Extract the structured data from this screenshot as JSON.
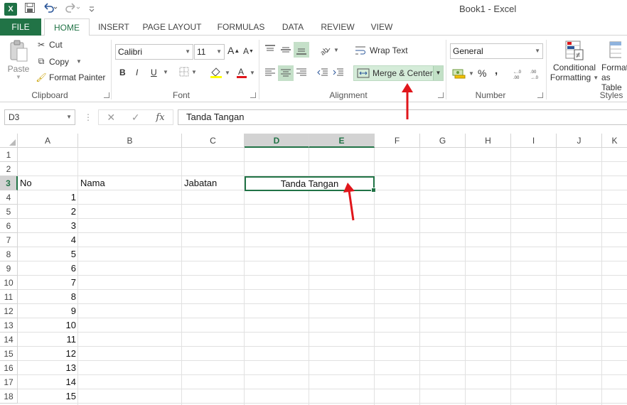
{
  "window": {
    "title": "Book1 - Excel",
    "app_icon": "X"
  },
  "qat": {
    "save_icon": "save-icon",
    "undo_icon": "undo-icon",
    "redo_icon": "redo-icon"
  },
  "tabs": [
    "FILE",
    "HOME",
    "INSERT",
    "PAGE LAYOUT",
    "FORMULAS",
    "DATA",
    "REVIEW",
    "VIEW"
  ],
  "ribbon": {
    "clipboard": {
      "paste": "Paste",
      "cut": "Cut",
      "copy": "Copy",
      "format_painter": "Format Painter",
      "label": "Clipboard"
    },
    "font": {
      "name": "Calibri",
      "size": "11",
      "bold": "B",
      "italic": "I",
      "underline": "U",
      "label": "Font",
      "grow": "A",
      "shrink": "A"
    },
    "alignment": {
      "wrap_text": "Wrap Text",
      "merge_center": "Merge & Center",
      "label": "Alignment"
    },
    "number": {
      "format": "General",
      "percent": "%",
      "comma": ",",
      "inc_decimal": ".00 .0",
      "label": "Number"
    },
    "styles": {
      "conditional_1": "Conditional",
      "conditional_2": "Formatting",
      "format_table_1": "Format as",
      "format_table_2": "Table",
      "label": "Styles"
    }
  },
  "formula_bar": {
    "name_box": "D3",
    "fx": "fx",
    "value": "Tanda Tangan"
  },
  "sheet": {
    "columns": [
      "A",
      "B",
      "C",
      "D",
      "E",
      "F",
      "G",
      "H",
      "I",
      "J",
      "K"
    ],
    "rows": [
      "1",
      "2",
      "3",
      "4",
      "5",
      "6",
      "7",
      "8",
      "9",
      "10",
      "11",
      "12",
      "13",
      "14",
      "15",
      "16",
      "17",
      "18"
    ],
    "header": {
      "no": "No",
      "nama": "Nama",
      "jabatan": "Jabatan",
      "tanda_tangan": "Tanda Tangan"
    },
    "numbers": [
      "1",
      "2",
      "3",
      "4",
      "5",
      "6",
      "7",
      "8",
      "9",
      "10",
      "11",
      "12",
      "13",
      "14",
      "15"
    ]
  },
  "colors": {
    "accent": "#217346",
    "arrow": "#e0161b",
    "highlight": "#c5e0c9"
  }
}
